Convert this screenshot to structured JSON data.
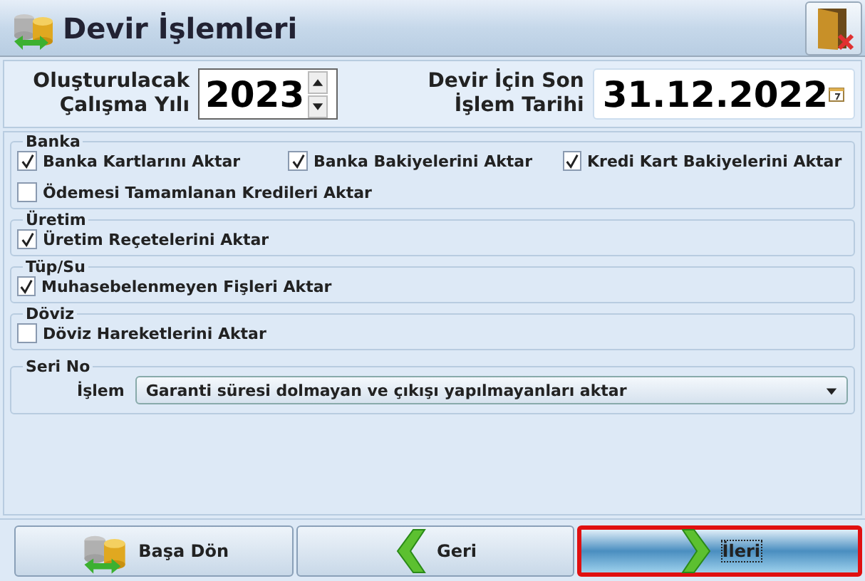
{
  "window": {
    "title": "Devir İşlemleri"
  },
  "form": {
    "year_label": "Oluşturulacak Çalışma Yılı",
    "year_value": "2023",
    "date_label": "Devir İçin Son İşlem Tarihi",
    "date_value": "31.12.2022"
  },
  "groups": [
    {
      "title": "Banka",
      "options": [
        {
          "label": "Banka Kartlarını Aktar",
          "checked": true
        },
        {
          "label": "Banka Bakiyelerini Aktar",
          "checked": true
        },
        {
          "label": "Kredi Kart Bakiyelerini Aktar",
          "checked": true
        },
        {
          "label": "Ödemesi Tamamlanan Kredileri Aktar",
          "checked": false
        }
      ]
    },
    {
      "title": "Üretim",
      "options": [
        {
          "label": "Üretim Reçetelerini Aktar",
          "checked": true
        }
      ]
    },
    {
      "title": "Tüp/Su",
      "options": [
        {
          "label": "Muhasebelenmeyen Fişleri Aktar",
          "checked": true
        }
      ]
    },
    {
      "title": "Döviz",
      "options": [
        {
          "label": "Döviz Hareketlerini Aktar",
          "checked": false
        }
      ]
    }
  ],
  "serial": {
    "title": "Seri No",
    "label": "İşlem",
    "value": "Garanti süresi dolmayan ve çıkışı yapılmayanları aktar"
  },
  "buttons": [
    {
      "label": "Başa Dön",
      "kind": "coins",
      "selected": false
    },
    {
      "label": "Geri",
      "kind": "back",
      "selected": false
    },
    {
      "label": "İleri",
      "kind": "next",
      "selected": true
    }
  ]
}
